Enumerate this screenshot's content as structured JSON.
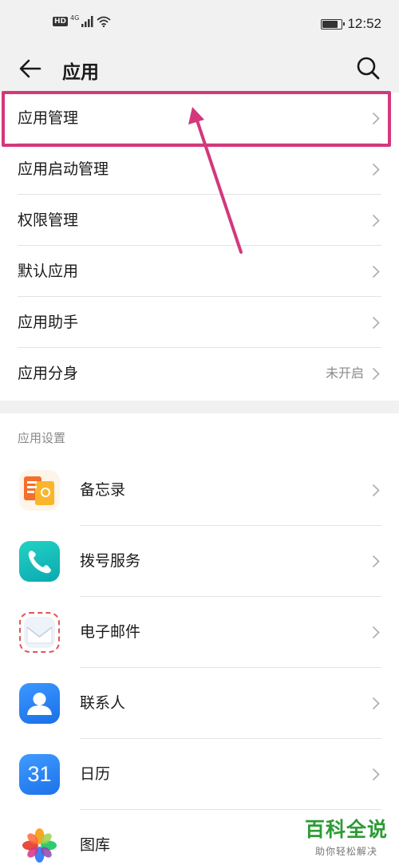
{
  "status_bar": {
    "left_badge": "HD",
    "network": "4G",
    "time": "12:52",
    "battery_level": 0.85
  },
  "header": {
    "title": "应用",
    "back_icon": "arrow-left-icon",
    "search_icon": "search-icon"
  },
  "menu": {
    "items": [
      {
        "label": "应用管理",
        "value": ""
      },
      {
        "label": "应用启动管理",
        "value": ""
      },
      {
        "label": "权限管理",
        "value": ""
      },
      {
        "label": "默认应用",
        "value": ""
      },
      {
        "label": "应用助手",
        "value": ""
      },
      {
        "label": "应用分身",
        "value": "未开启"
      }
    ]
  },
  "app_settings": {
    "section_title": "应用设置",
    "apps": [
      {
        "label": "备忘录",
        "icon": "notepad-icon"
      },
      {
        "label": "拨号服务",
        "icon": "phone-icon"
      },
      {
        "label": "电子邮件",
        "icon": "email-icon"
      },
      {
        "label": "联系人",
        "icon": "contacts-icon"
      },
      {
        "label": "日历",
        "icon": "calendar-icon",
        "icon_text": "31"
      },
      {
        "label": "图库",
        "icon": "gallery-icon"
      }
    ]
  },
  "watermark": {
    "main": "百科全说",
    "sub": "助你轻松解决"
  },
  "colors": {
    "highlight": "#d3387b",
    "brand_green": "#2c9b35",
    "background": "#f1f1f1"
  }
}
